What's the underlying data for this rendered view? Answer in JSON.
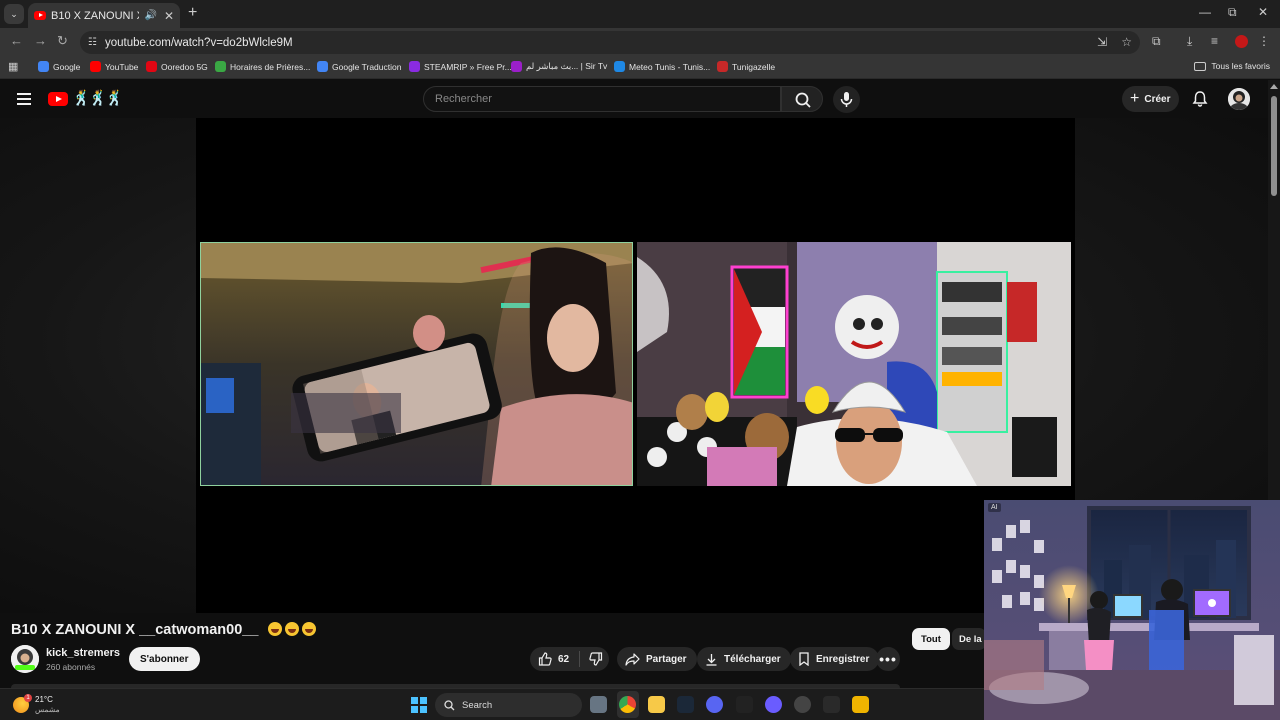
{
  "browser": {
    "tab": {
      "title": "B10 X ZANOUNI X __catwoman00__ 😂😂😂",
      "close": "✕"
    },
    "new_tab": "+",
    "window_controls": {
      "minimize": "—",
      "restore": "⧉",
      "close": "✕"
    },
    "url": "youtube.com/watch?v=do2bWlcle9M",
    "bookmarks": [
      {
        "label": "Google",
        "color": "#4285f4"
      },
      {
        "label": "YouTube",
        "color": "#ff0000"
      },
      {
        "label": "Ooredoo 5G",
        "color": "#e30613"
      },
      {
        "label": "Horaires de Prières...",
        "color": "#3aa844"
      },
      {
        "label": "Google Traduction",
        "color": "#4285f4"
      },
      {
        "label": "STEAMRIP » Free Pr...",
        "color": "#8a2be2"
      },
      {
        "label": "بث مباشر لم... | Sir Tv",
        "color": "#9b1fc9"
      },
      {
        "label": "Meteo Tunis - Tunis...",
        "color": "#1e88e5"
      },
      {
        "label": "Tunigazelle",
        "color": "#c62828"
      }
    ],
    "all_bookmarks": "Tous les favoris"
  },
  "youtube": {
    "search_placeholder": "Rechercher",
    "create_label": "Créer",
    "video": {
      "title": "B10 X ZANOUNI X __catwoman00__",
      "title_emoji_count": 3,
      "channel": "kick_stremers",
      "subscribers": "260 abonnés",
      "subscribe_label": "S'abonner",
      "likes": "62",
      "share_label": "Partager",
      "download_label": "Télécharger",
      "save_label": "Enregistrer",
      "more_label": "•••"
    },
    "chips": [
      "Tout",
      "De la"
    ]
  },
  "wallpaper_widget": {
    "badge": "AI"
  },
  "taskbar": {
    "weather": {
      "temp": "21°C",
      "condition": "مشمس"
    },
    "search_label": "Search"
  },
  "colors": {
    "youtube_red": "#ff0000",
    "windows_accent": "#4cc2ff",
    "browser_dark": "#1f1f1f"
  }
}
